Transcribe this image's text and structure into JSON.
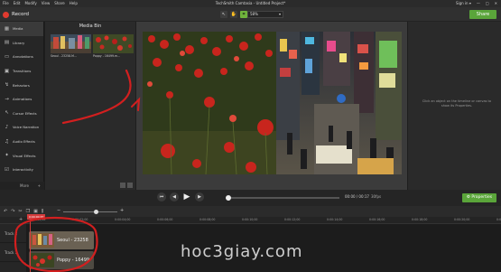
{
  "menu": [
    "File",
    "Edit",
    "Modify",
    "View",
    "Share",
    "Help"
  ],
  "app_title": "TechSmith Camtasia - Untitled Project*",
  "account": {
    "sign_in": "Sign in ▾",
    "window_controls": [
      "—",
      "□",
      "✕"
    ]
  },
  "toolbar": {
    "record_label": "Record",
    "tool_icons": [
      "pointer-icon",
      "hand-icon",
      "crop-icon"
    ],
    "zoom_value": "58%",
    "share_label": "Share"
  },
  "sidebar": {
    "items": [
      {
        "label": "Media",
        "icon": "media-icon",
        "glyph": "▦"
      },
      {
        "label": "Library",
        "icon": "library-icon",
        "glyph": "▤"
      },
      {
        "label": "Annotations",
        "icon": "annotations-icon",
        "glyph": "▭"
      },
      {
        "label": "Transitions",
        "icon": "transitions-icon",
        "glyph": "▣"
      },
      {
        "label": "Behaviors",
        "icon": "behaviors-icon",
        "glyph": "↯"
      },
      {
        "label": "Animations",
        "icon": "animations-icon",
        "glyph": "→"
      },
      {
        "label": "Cursor Effects",
        "icon": "cursor-icon",
        "glyph": "↖"
      },
      {
        "label": "Voice Narration",
        "icon": "microphone-icon",
        "glyph": "♪"
      },
      {
        "label": "Audio Effects",
        "icon": "audio-icon",
        "glyph": "♫"
      },
      {
        "label": "Visual Effects",
        "icon": "visual-effects-icon",
        "glyph": "✦"
      },
      {
        "label": "Interactivity",
        "icon": "interactivity-icon",
        "glyph": "☑"
      }
    ],
    "more_label": "More",
    "add_label": "+"
  },
  "media_bin": {
    "title": "Media Bin",
    "items": [
      {
        "caption": "Seoul - 23258.M..."
      },
      {
        "caption": "Poppy - 16499.m..."
      }
    ]
  },
  "properties": {
    "hint": "Click an object on the timeline or canvas to show its Properties.",
    "button_label": "Properties"
  },
  "playback": {
    "time": "00:00 / 00:17",
    "fps": "30fps"
  },
  "timeline": {
    "playhead_time": "0:00:00;00",
    "ruler_ticks": [
      "0:00:00;00",
      "0:00:02;00",
      "0:00:04;00",
      "0:00:06;00",
      "0:00:08;00",
      "0:00:10;00",
      "0:00:12;00",
      "0:00:14;00",
      "0:00:16;00",
      "0:00:18;00",
      "0:00:20;00",
      "0:00:22;00"
    ],
    "tracks": [
      {
        "name": "Track 2",
        "clip_label": "Seoul - 23258"
      },
      {
        "name": "Track 1",
        "clip_label": "Poppy - 16499"
      }
    ]
  },
  "watermark": "hoc3giay.com"
}
